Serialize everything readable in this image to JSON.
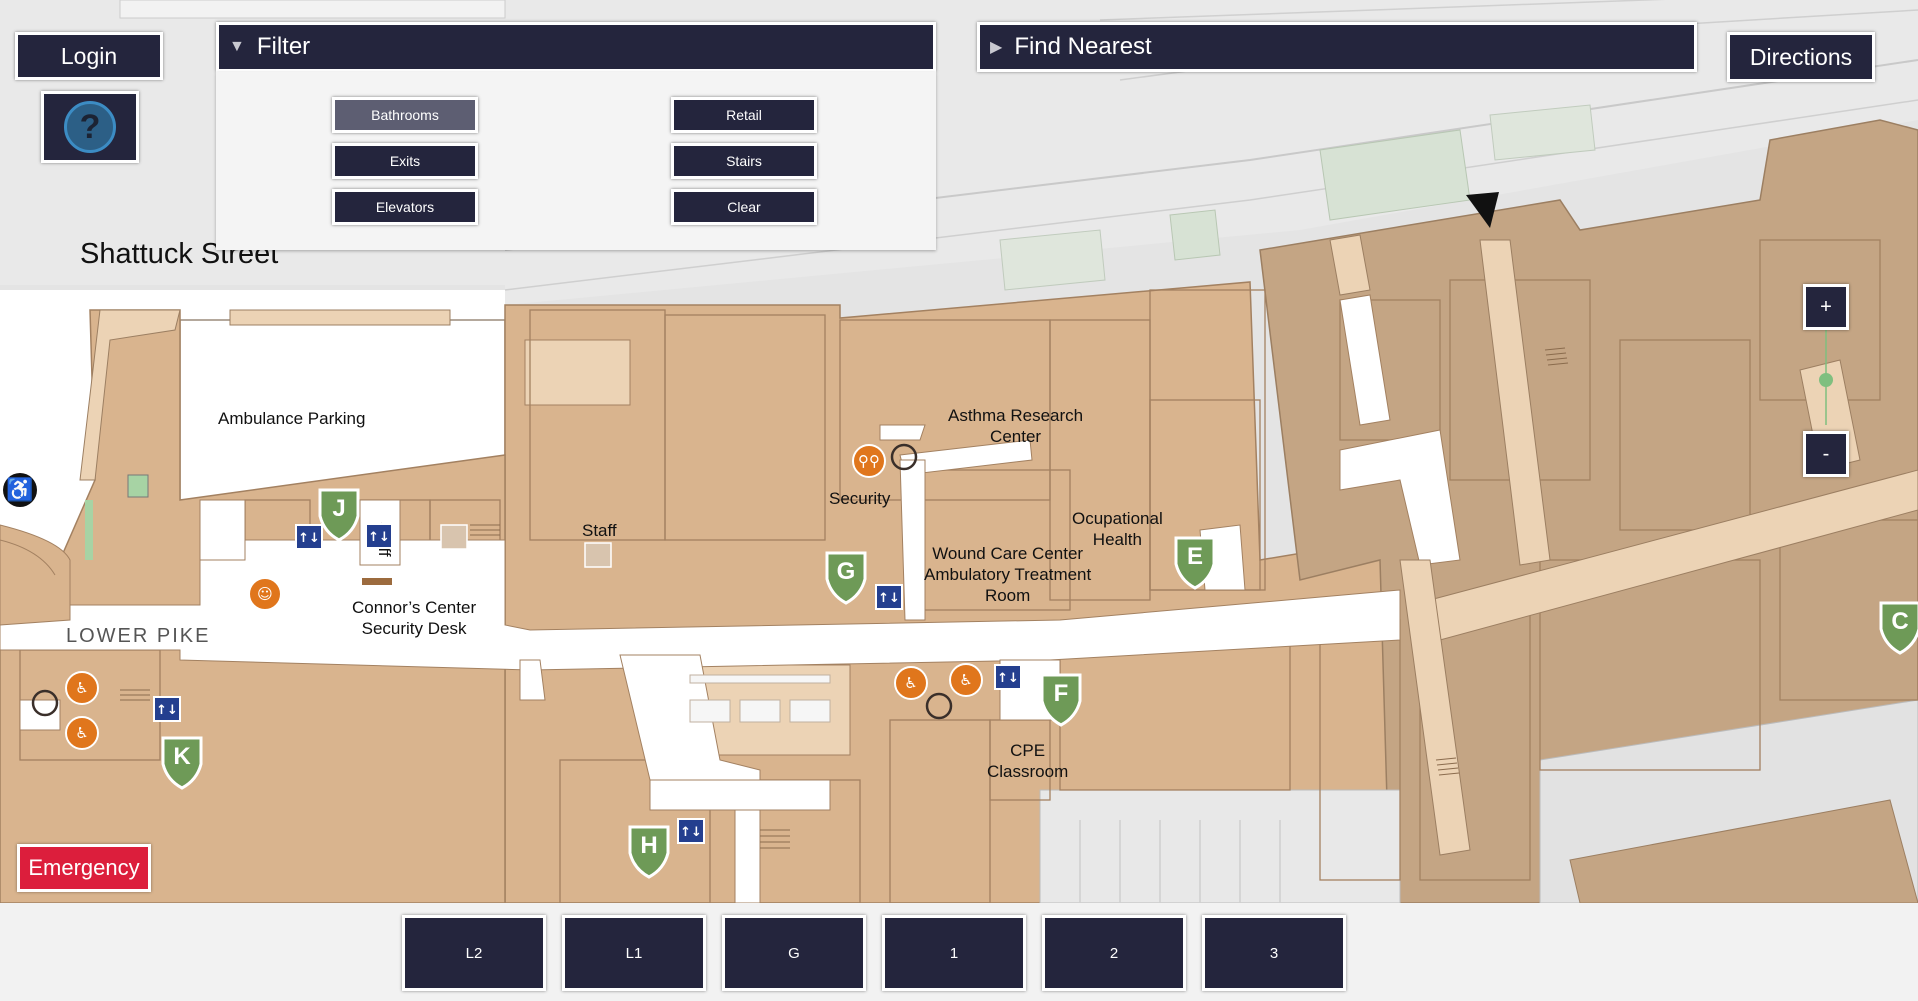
{
  "header": {
    "login_label": "Login",
    "filter_title": "Filter",
    "find_nearest_title": "Find Nearest",
    "directions_label": "Directions"
  },
  "filter": {
    "buttons": {
      "bathrooms": "Bathrooms",
      "retail": "Retail",
      "exits": "Exits",
      "stairs": "Stairs",
      "elevators": "Elevators",
      "clear": "Clear"
    },
    "active": "Bathrooms"
  },
  "map": {
    "street": "Shattuck Street",
    "labels": {
      "ambulance_parking": "Ambulance Parking",
      "staff_vertical": "Staff",
      "staff": "Staff",
      "connors_center": "Connor’s Center\nSecurity Desk",
      "lower_pike": "LOWER PIKE",
      "asthma_research": "Asthma Research\nCenter",
      "security": "Security",
      "wound_care": "Wound Care Center\nAmbulatory Treatment\nRoom",
      "ocupational_health": "Ocupational\nHealth",
      "cpe_classroom": "CPE\nClassroom"
    },
    "markers": [
      "J",
      "G",
      "E",
      "F",
      "H",
      "K",
      "C"
    ],
    "colors": {
      "building": "#d9b48e",
      "building_dark": "#c4a584",
      "corridor": "#ffffff",
      "street_area": "#e4e4e4",
      "marker_green": "#6e9a57",
      "amenity_orange": "#e0761c",
      "elevator_blue": "#243f8f",
      "emergency_red": "#dc1e3c",
      "navy": "#24253d"
    }
  },
  "controls": {
    "zoom_in": "+",
    "zoom_out": "-",
    "emergency_label": "Emergency"
  },
  "floors": [
    "L2",
    "L1",
    "G",
    "1",
    "2",
    "3"
  ]
}
